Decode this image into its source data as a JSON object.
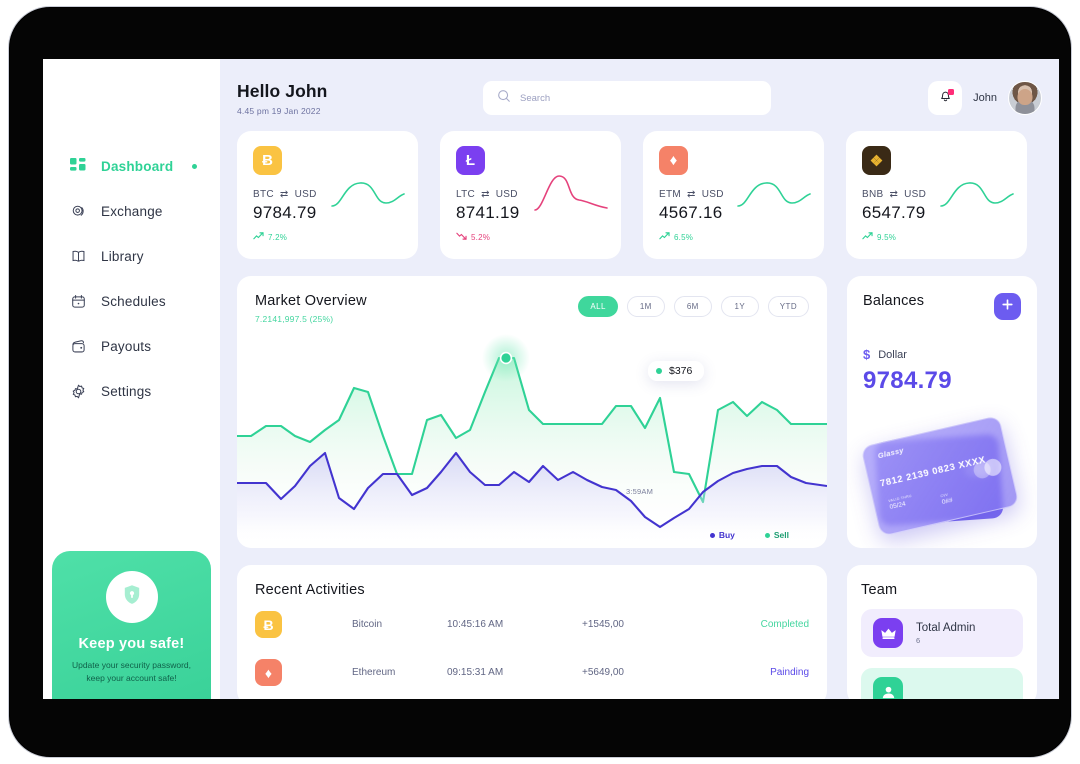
{
  "sidebar": {
    "items": [
      {
        "label": "Dashboard",
        "icon": "grid-icon",
        "active": true
      },
      {
        "label": "Exchange",
        "icon": "exchange-icon",
        "active": false
      },
      {
        "label": "Library",
        "icon": "book-icon",
        "active": false
      },
      {
        "label": "Schedules",
        "icon": "calendar-icon",
        "active": false
      },
      {
        "label": "Payouts",
        "icon": "wallet-icon",
        "active": false
      },
      {
        "label": "Settings",
        "icon": "gear-icon",
        "active": false
      }
    ],
    "promo": {
      "icon": "shield-lock-icon",
      "title": "Keep you safe!",
      "text": "Update your security password, keep your account safe!",
      "bg_color": "#45daa0"
    }
  },
  "header": {
    "greeting": "Hello John",
    "datetime": "4.45 pm 19 Jan 2022",
    "search_placeholder": "Search",
    "search_value": "",
    "search_icon": "search-icon",
    "bell_icon": "bell-icon",
    "has_notification": true,
    "user_name": "John",
    "avatar": "user-avatar"
  },
  "crypto_cards": [
    {
      "icon": "bitcoin-icon",
      "glyph": "Ƀ",
      "icon_bg": "#fac342",
      "from": "BTC",
      "to": "USD",
      "value": "9784.79",
      "change": "7.2%",
      "direction": "up",
      "change_color": "#2fd296",
      "spark_color": "#2fd296"
    },
    {
      "icon": "litecoin-icon",
      "glyph": "Ł",
      "icon_bg": "#7b3ff0",
      "from": "LTC",
      "to": "USD",
      "value": "8741.19",
      "change": "5.2%",
      "direction": "down",
      "change_color": "#e5427c",
      "spark_color": "#e5427c"
    },
    {
      "icon": "ethereum-icon",
      "glyph": "♦",
      "icon_bg": "#f58268",
      "from": "ETM",
      "to": "USD",
      "value": "4567.16",
      "change": "6.5%",
      "direction": "up",
      "change_color": "#2fd296",
      "spark_color": "#2fd296"
    },
    {
      "icon": "binance-icon",
      "glyph": "❖",
      "icon_bg": "#3a2a16",
      "from": "BNB",
      "to": "USD",
      "value": "6547.79",
      "change": "9.5%",
      "direction": "up",
      "change_color": "#2fd296",
      "spark_color": "#2fd296"
    }
  ],
  "market": {
    "title": "Market Overview",
    "subtitle": "7.2141,997.5 (25%)",
    "ranges": [
      {
        "label": "ALL",
        "active": true
      },
      {
        "label": "1M",
        "active": false
      },
      {
        "label": "6M",
        "active": false
      },
      {
        "label": "1Y",
        "active": false
      },
      {
        "label": "YTD",
        "active": false
      }
    ],
    "tooltip_value": "$376",
    "crosshair_time": "3:59AM",
    "legend": [
      {
        "label": "Buy",
        "color": "#4334cf"
      },
      {
        "label": "Sell",
        "color": "#2fd296"
      }
    ]
  },
  "chart_data": {
    "type": "area",
    "title": "Market Overview",
    "xlabel": "",
    "ylabel": "",
    "grid": false,
    "legend_position": "bottom-right",
    "annotations": [
      {
        "text": "$376",
        "x_label": "3:59AM",
        "series": "Sell",
        "value": 376
      }
    ],
    "x": [
      0,
      1,
      2,
      3,
      4,
      5,
      6,
      7,
      8,
      9,
      10,
      11,
      12,
      13,
      14,
      15,
      16,
      17,
      18,
      19,
      20,
      21,
      22,
      23,
      24,
      25,
      26,
      27,
      28,
      29,
      30,
      31,
      32,
      33,
      34,
      35,
      36,
      37
    ],
    "series": [
      {
        "name": "Sell",
        "color": "#2fd296",
        "values": [
          236,
          236,
          252,
          252,
          236,
          226,
          248,
          265,
          316,
          310,
          236,
          176,
          176,
          262,
          270,
          232,
          248,
          310,
          376,
          376,
          286,
          264,
          264,
          264,
          264,
          264,
          296,
          296,
          260,
          306,
          178,
          176,
          130,
          276,
          290,
          268,
          290,
          276,
          264,
          264,
          264
        ]
      },
      {
        "name": "Buy",
        "color": "#4334cf",
        "values": [
          162,
          162,
          162,
          138,
          158,
          188,
          208,
          140,
          124,
          156,
          178,
          178,
          150,
          160,
          184,
          212,
          186,
          166,
          166,
          186,
          172,
          196,
          176,
          188,
          176,
          166,
          162,
          146,
          122,
          106,
          120,
          134,
          158,
          174,
          186,
          192,
          196,
          196,
          180,
          172,
          166
        ]
      }
    ],
    "ylim": [
      100,
      400
    ]
  },
  "balances": {
    "title": "Balances",
    "add_button_icon": "plus-icon",
    "currency_symbol": "$",
    "currency_name": "Dollar",
    "amount": "9784.79",
    "card": {
      "brand": "Glassy",
      "number": "7812 2139 0823 XXXX",
      "valid_thru_label": "VALID THRU",
      "valid_thru": "05/24",
      "cvv_label": "CVV",
      "cvv": "0##"
    }
  },
  "activities": {
    "title": "Recent Activities",
    "rows": [
      {
        "icon": "bitcoin-icon",
        "glyph": "Ƀ",
        "icon_bg": "#fac342",
        "name": "Bitcoin",
        "time": "10:45:16 AM",
        "amount": "+1545,00",
        "status": "Completed",
        "status_color": "#45d6a0"
      },
      {
        "icon": "ethereum-icon",
        "glyph": "♦",
        "icon_bg": "#f58268",
        "name": "Ethereum",
        "time": "09:15:31 AM",
        "amount": "+5649,00",
        "status": "Painding",
        "status_color": "#5b4ae8"
      }
    ]
  },
  "team": {
    "title": "Team",
    "rows": [
      {
        "icon": "crown-icon",
        "icon_bg": "#7b3ff0",
        "row_bg": "#f1edfd",
        "role": "Total Admin",
        "count": "6"
      },
      {
        "icon": "users-icon",
        "icon_bg": "#2fd296",
        "row_bg": "#dcf9ee",
        "role": "",
        "count": ""
      }
    ]
  }
}
